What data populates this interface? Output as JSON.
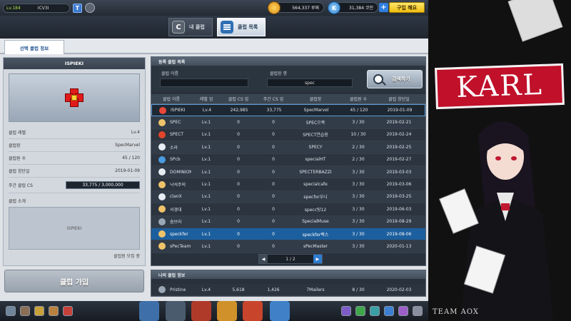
{
  "top": {
    "level": "Lv.184",
    "nickname": "ICV3I",
    "t_label": "T",
    "lucci": "564,337 루찌",
    "coin_label": "K",
    "coins": "31,384 코인",
    "plus": "+",
    "buy": "구입 해요"
  },
  "tabs": {
    "my_club": "내 클럽",
    "my_club_icon": "C",
    "club_list": "클럽 목록"
  },
  "subtab": "선택 클럽 정보",
  "left": {
    "title": "ISPIEKI",
    "rows": [
      {
        "label": "클럽 레벨",
        "value": "Lv.4"
      },
      {
        "label": "클럽장",
        "value": "SpecMarvel"
      },
      {
        "label": "클럽원 수",
        "value": "45  /  120"
      },
      {
        "label": "클럽 창단일",
        "value": "2019-01-09"
      }
    ],
    "cs_label": "주간 클럽 CS",
    "cs_value": "33,775 / 3,000,000",
    "intro_label": "클럽 소개",
    "intro_text": "ISPIEKI",
    "recruit": "클럽원 모집 중",
    "join": "클럽 가입"
  },
  "right": {
    "title": "등록 클럽 목록",
    "name_label": "클럽 이름",
    "master_label": "클럽장 명",
    "name_value": "",
    "master_value": "spec",
    "search_btn": "검색하기",
    "headers": [
      "클럽 이름",
      "레벨 업",
      "클럽 CS 업",
      "주간 CS 업",
      "클럽장",
      "클럽원 수",
      "클럽 창단일"
    ],
    "rows": [
      {
        "name": "ISPIEKI",
        "level": "Lv.4",
        "cs": "242,985",
        "weekly": "33,775",
        "master": "SpecMarvel",
        "members": "45 / 120",
        "date": "2019-01-09",
        "color": "#e8483a"
      },
      {
        "name": "SPEC",
        "level": "Lv.1",
        "cs": "0",
        "weekly": "0",
        "master": "SPEC으쪽",
        "members": "3 / 30",
        "date": "2019-02-21",
        "color": "#f0c36a"
      },
      {
        "name": "SPECT",
        "level": "Lv.1",
        "cs": "0",
        "weekly": "0",
        "master": "SPECT연습용",
        "members": "10 / 30",
        "date": "2019-02-24",
        "color": "#e0452a"
      },
      {
        "name": "소라",
        "level": "Lv.1",
        "cs": "0",
        "weekly": "0",
        "master": "SPECY",
        "members": "2 / 30",
        "date": "2019-02-25",
        "color": "#e7edf3"
      },
      {
        "name": "SPcb",
        "level": "Lv.1",
        "cs": "0",
        "weekly": "0",
        "master": "specialHT",
        "members": "2 / 30",
        "date": "2019-02-27",
        "color": "#4a9be0"
      },
      {
        "name": "DOMINION",
        "level": "Lv.1",
        "cs": "0",
        "weekly": "0",
        "master": "SPECTERBAZZI",
        "members": "3 / 30",
        "date": "2019-03-03",
        "color": "#e7edf3"
      },
      {
        "name": "낙석주의",
        "level": "Lv.1",
        "cs": "0",
        "weekly": "0",
        "master": "specialcafe",
        "members": "3 / 30",
        "date": "2019-03-06",
        "color": "#f0c36a"
      },
      {
        "name": "clanX",
        "level": "Lv.1",
        "cs": "0",
        "weekly": "0",
        "master": "specfor우니",
        "members": "3 / 30",
        "date": "2019-03-25",
        "color": "#e7edf3"
      },
      {
        "name": "서경대",
        "level": "Lv.1",
        "cs": "0",
        "weekly": "0",
        "master": "specc탕12",
        "members": "3 / 30",
        "date": "2019-06-03",
        "color": "#f0c36a"
      },
      {
        "name": "솜브라",
        "level": "Lv.1",
        "cs": "0",
        "weekly": "0",
        "master": "SpecialMuse",
        "members": "3 / 30",
        "date": "2019-08-29",
        "color": "#9aa7b6"
      },
      {
        "name": "speckfer",
        "level": "Lv.1",
        "cs": "0",
        "weekly": "0",
        "master": "speckfer렉스",
        "members": "3 / 30",
        "date": "2019-08-06",
        "color": "#f0c36a"
      },
      {
        "name": "sPecTeam",
        "level": "Lv.1",
        "cs": "0",
        "weekly": "0",
        "master": "sPecMaster",
        "members": "3 / 30",
        "date": "2020-01-13",
        "color": "#f0c36a"
      }
    ],
    "page": "1 / 2"
  },
  "my_club": {
    "title": "나의 클럽 정보",
    "name": "Pristine",
    "level": "Lv.4",
    "cs": "5,618",
    "weekly": "1,426",
    "master": "7Mailers",
    "members": "8 / 30",
    "date": "2020-02-03"
  },
  "art": {
    "title": "KARL",
    "team": "TEAM AOX"
  },
  "icons": [
    "settings-icon",
    "home-icon",
    "chat-icon",
    "inventory-icon",
    "mail-icon"
  ]
}
